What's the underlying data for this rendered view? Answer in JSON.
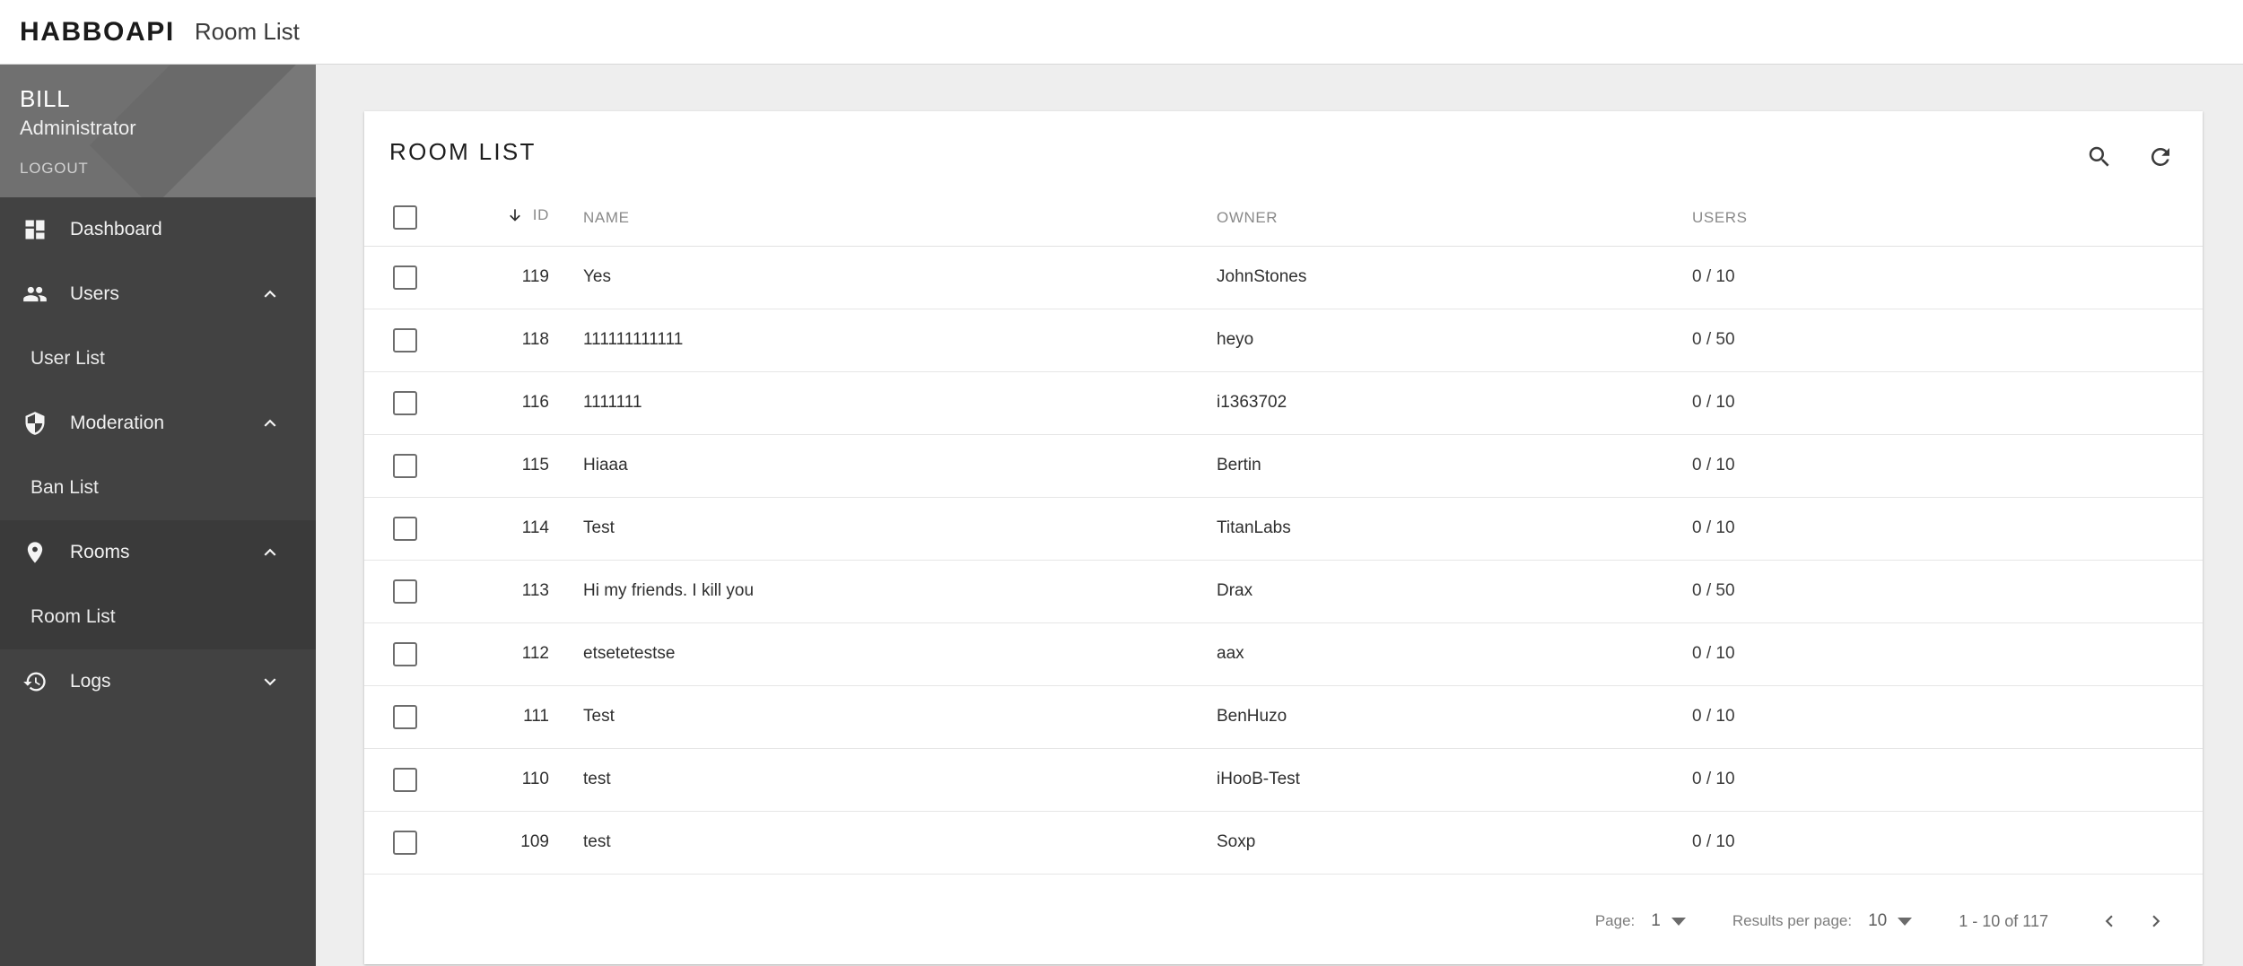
{
  "topbar": {
    "brand": "HABBOAPI",
    "page_title": "Room List"
  },
  "sidebar": {
    "user": {
      "name": "BILL",
      "role": "Administrator",
      "logout": "LOGOUT"
    },
    "items": [
      {
        "label": "Dashboard",
        "icon": "dashboard-icon",
        "expandable": false
      },
      {
        "label": "Users",
        "icon": "people-icon",
        "expandable": true,
        "chevron": "chevron-up-icon"
      },
      {
        "label": "User List",
        "sub": true
      },
      {
        "label": "Moderation",
        "icon": "shield-icon",
        "expandable": true,
        "chevron": "chevron-up-icon"
      },
      {
        "label": "Ban List",
        "sub": true
      },
      {
        "label": "Rooms",
        "icon": "location-pin-icon",
        "expandable": true,
        "chevron": "chevron-up-icon",
        "active": true
      },
      {
        "label": "Room List",
        "sub": true,
        "active": true
      },
      {
        "label": "Logs",
        "icon": "history-icon",
        "expandable": true,
        "chevron": "chevron-down-icon"
      }
    ]
  },
  "card": {
    "title": "ROOM LIST",
    "actions": [
      {
        "name": "search-icon",
        "label": "Search"
      },
      {
        "name": "refresh-icon",
        "label": "Refresh"
      }
    ]
  },
  "table": {
    "columns": [
      "ID",
      "NAME",
      "OWNER",
      "USERS"
    ],
    "sort": {
      "column": "ID",
      "direction": "desc"
    },
    "rows": [
      {
        "id": "119",
        "name": "Yes",
        "owner": "JohnStones",
        "users": "0 / 10"
      },
      {
        "id": "118",
        "name": "111111111111",
        "owner": "heyo",
        "users": "0 / 50"
      },
      {
        "id": "116",
        "name": "1111111",
        "owner": "i1363702",
        "users": "0 / 10"
      },
      {
        "id": "115",
        "name": "Hiaaa",
        "owner": "Bertin",
        "users": "0 / 10"
      },
      {
        "id": "114",
        "name": "Test",
        "owner": "TitanLabs",
        "users": "0 / 10"
      },
      {
        "id": "113",
        "name": "Hi my friends. I kill you",
        "owner": "Drax",
        "users": "0 / 50"
      },
      {
        "id": "112",
        "name": "etsetetestse",
        "owner": "aax",
        "users": "0 / 10"
      },
      {
        "id": "111",
        "name": "Test",
        "owner": "BenHuzo",
        "users": "0 / 10"
      },
      {
        "id": "110",
        "name": "test",
        "owner": "iHooB-Test",
        "users": "0 / 10"
      },
      {
        "id": "109",
        "name": "test",
        "owner": "Soxp",
        "users": "0 / 10"
      }
    ]
  },
  "paginator": {
    "page_label": "Page:",
    "page_value": "1",
    "per_page_label": "Results per page:",
    "per_page_value": "10",
    "range": "1 - 10 of 117",
    "prev_icon": "chevron-left-icon",
    "next_icon": "chevron-right-icon"
  },
  "colors": {
    "sidebar_bg": "#424242",
    "sidebar_active": "#3a3a3a",
    "user_panel_bg": "#707070",
    "page_bg": "#eeeeee",
    "card_bg": "#ffffff"
  }
}
